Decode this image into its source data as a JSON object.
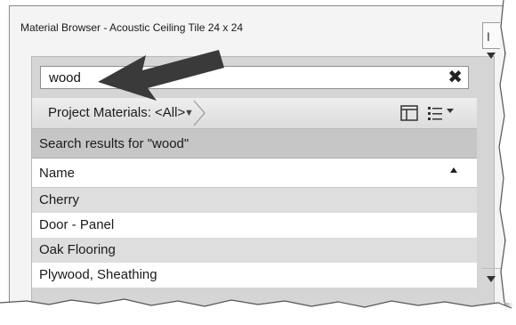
{
  "window": {
    "title": "Material Browser - Acoustic Ceiling Tile 24 x 24"
  },
  "search": {
    "value": "wood",
    "clear_icon": "close-x-icon"
  },
  "toolbar": {
    "library_filter": "Project Materials: <All>",
    "layout_icon": "panel-layout-icon",
    "view_icon": "list-view-icon"
  },
  "results": {
    "header": "Search results for \"wood\"",
    "column_name": "Name",
    "sort": "ascending",
    "rows": [
      {
        "name": "Cherry"
      },
      {
        "name": "Door - Panel"
      },
      {
        "name": "Oak Flooring"
      },
      {
        "name": "Plywood, Sheathing"
      }
    ]
  },
  "right_panel": {
    "tab_label": "I"
  },
  "colors": {
    "row_alt": "#dedede",
    "results_header": "#c6c6c6",
    "annotation_arrow": "#3a3a3a"
  }
}
